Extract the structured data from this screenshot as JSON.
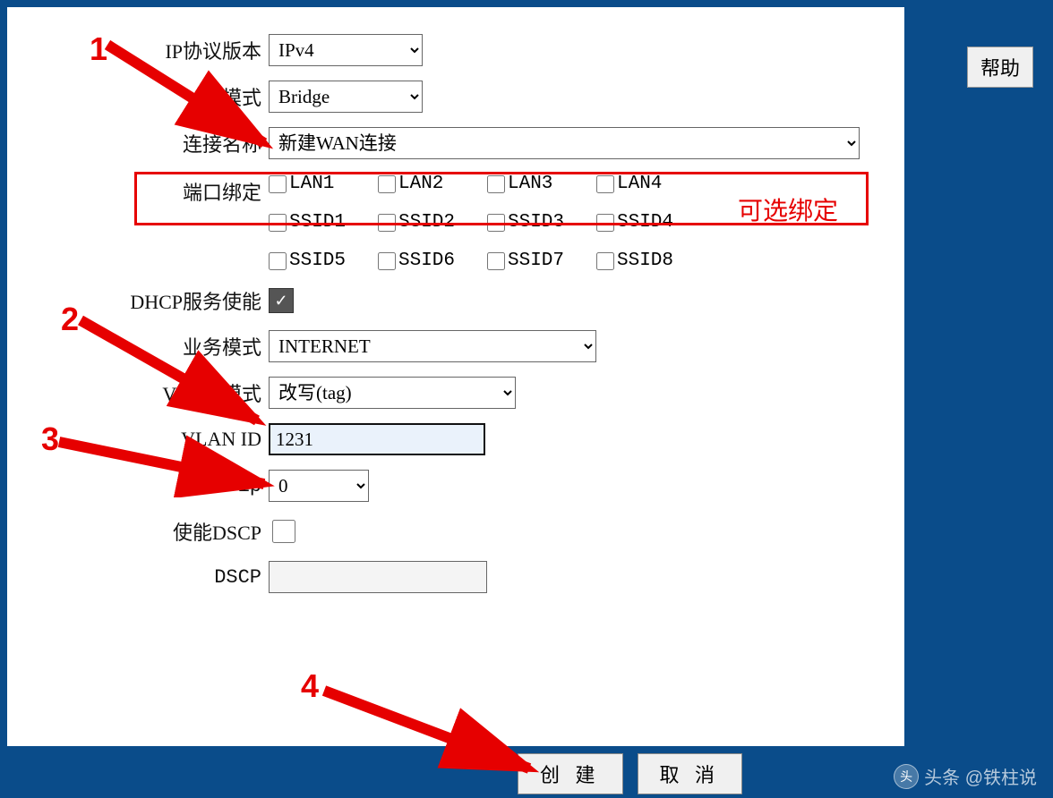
{
  "help_label": "帮助",
  "fields": {
    "ip_version": {
      "label": "IP协议版本",
      "value": "IPv4"
    },
    "mode": {
      "label": "模式",
      "value": "Bridge"
    },
    "conn_name": {
      "label": "连接名称",
      "value": "新建WAN连接"
    },
    "port_bind": {
      "label": "端口绑定",
      "rows": [
        [
          "LAN1",
          "LAN2",
          "LAN3",
          "LAN4"
        ],
        [
          "SSID1",
          "SSID2",
          "SSID3",
          "SSID4"
        ],
        [
          "SSID5",
          "SSID6",
          "SSID7",
          "SSID8"
        ]
      ]
    },
    "dhcp": {
      "label": "DHCP服务使能",
      "checked": true
    },
    "biz_mode": {
      "label": "业务模式",
      "value": "INTERNET"
    },
    "vlan_mode": {
      "label": "VLAN 模式",
      "value": "改写(tag)"
    },
    "vlan_id": {
      "label": "VLAN ID",
      "value": "1231"
    },
    "p8021": {
      "label": "802.1p",
      "value": "0"
    },
    "dscp_en": {
      "label": "使能DSCP",
      "checked": false
    },
    "dscp": {
      "label": "DSCP",
      "value": ""
    }
  },
  "buttons": {
    "create": "创 建",
    "cancel": "取 消"
  },
  "annotations": {
    "n1": "1",
    "n2": "2",
    "n3": "3",
    "n4": "4",
    "hint": "可选绑定"
  },
  "watermark": "头条 @铁柱说"
}
